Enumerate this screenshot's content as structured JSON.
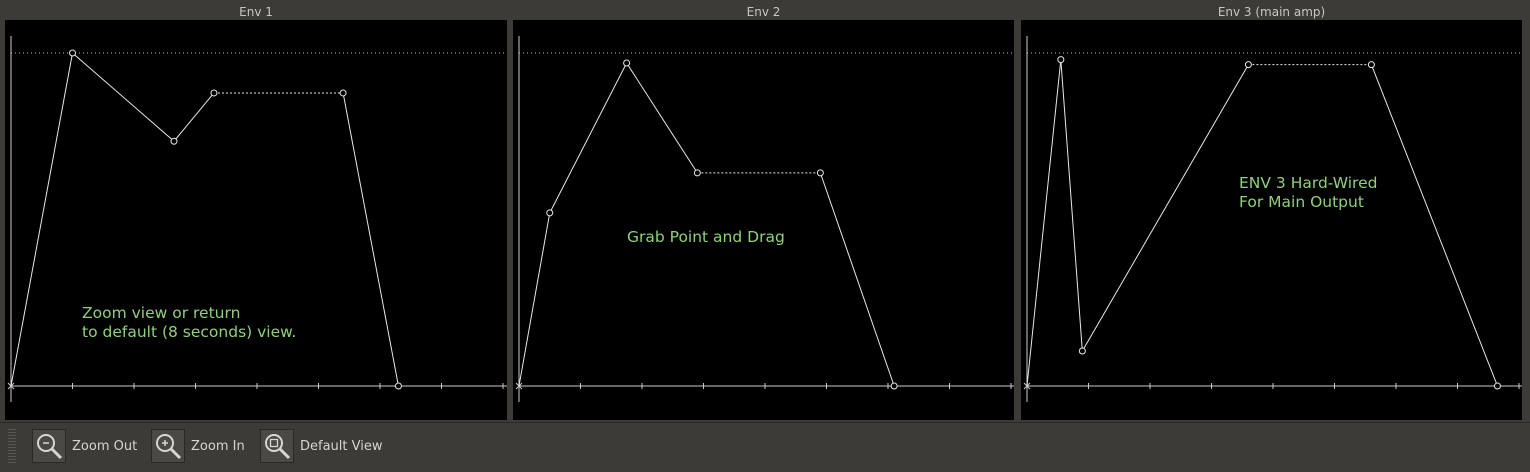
{
  "panels": [
    {
      "title": "Env 1",
      "hint": "Zoom view or return\nto default (8 seconds) view.",
      "points": [
        [
          0,
          0
        ],
        [
          1,
          1
        ],
        [
          2.65,
          0.735
        ],
        [
          3.3,
          0.88
        ],
        [
          5.4,
          0.88
        ],
        [
          6.3,
          0
        ]
      ],
      "sustain": [
        3,
        4
      ]
    },
    {
      "title": "Env 2",
      "hint": "Grab Point and Drag",
      "points": [
        [
          0,
          0
        ],
        [
          0.5,
          0.52
        ],
        [
          1.75,
          0.97
        ],
        [
          2.9,
          0.64
        ],
        [
          4.9,
          0.64
        ],
        [
          6.1,
          0
        ]
      ],
      "sustain": [
        3,
        4
      ]
    },
    {
      "title": "Env 3 (main amp)",
      "hint": "ENV 3 Hard-Wired\nFor Main Output",
      "points": [
        [
          0,
          0
        ],
        [
          0.55,
          0.98
        ],
        [
          0.9,
          0.105
        ],
        [
          3.6,
          0.965
        ],
        [
          5.6,
          0.965
        ],
        [
          7.65,
          0
        ]
      ],
      "sustain": [
        3,
        4
      ]
    }
  ],
  "toolbar": {
    "zoom_out": "Zoom Out",
    "zoom_in": "Zoom In",
    "default_view": "Default View"
  },
  "colors": {
    "trace": "#e8e8e8",
    "hint": "#8fd07a",
    "background": "#000000"
  }
}
